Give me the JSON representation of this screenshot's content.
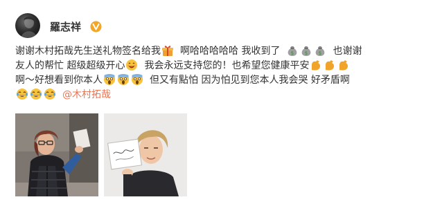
{
  "user": {
    "name": "羅志祥",
    "avatar_icon": "avatar-dark-portrait",
    "verified_icon": "verified-v-badge-icon",
    "verified_color": "#f5a623"
  },
  "post": {
    "line1": {
      "t1": "谢谢木村拓哉先生送礼物签名给我",
      "icon1": "gift-icon",
      "t2": "啊哈哈哈哈哈 我收到了",
      "icon2": "money-bag-icon",
      "t3": "也谢谢"
    },
    "line2": {
      "t1": "友人的帮忙 超级超级开心",
      "icon1": "happy-face-icon",
      "t2": "我会永远支持您的！也希望您健康平安",
      "icon2": "flexed-biceps-icon"
    },
    "line3": {
      "t1": "啊～好想看到你本人",
      "icon1": "screaming-face-icon",
      "t2": "但又有點怕 因为怕见到您本人我会哭 好矛盾啊"
    },
    "line4": {
      "icon1": "tears-of-joy-icon",
      "mention": "@木村拓哉"
    },
    "mention_color": "#eb7350"
  },
  "photos": [
    {
      "subject": "man-in-puffer-vest-holding-card"
    },
    {
      "subject": "man-holding-signed-card"
    }
  ]
}
